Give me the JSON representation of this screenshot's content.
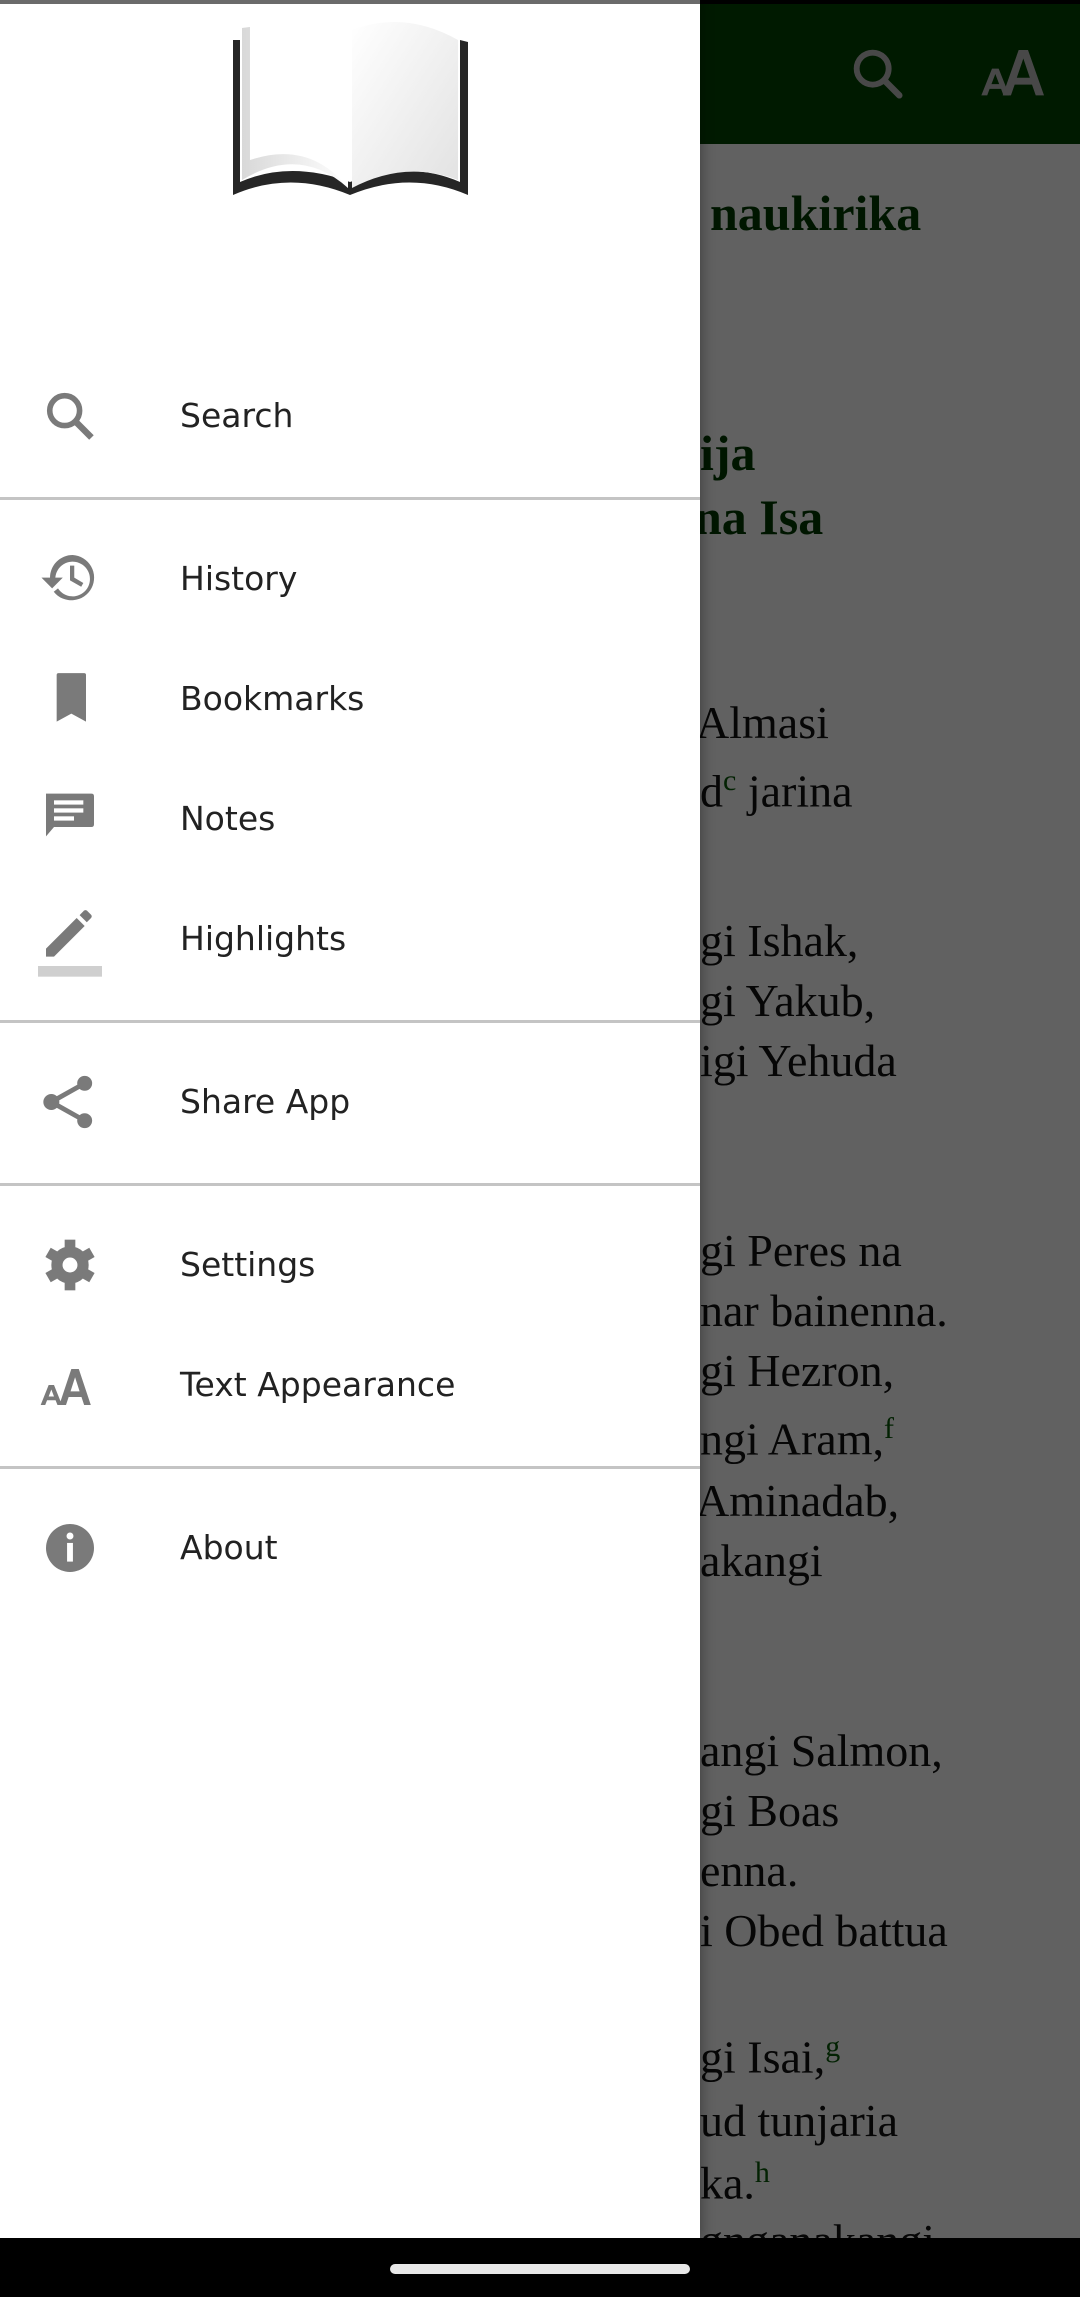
{
  "app": {
    "accent_color": "#004500",
    "icon_color": "#7a7a7a"
  },
  "appbar": {
    "search_icon": "search-icon",
    "text_appearance_icon": "text-size-icon"
  },
  "reader": {
    "lines": [
      {
        "text": "naukirika",
        "heading": true
      },
      {
        "text": "ija",
        "heading": true
      },
      {
        "text": "na Isa",
        "heading": true
      },
      {
        "text": "Almasi",
        "heading": false
      },
      {
        "text": "d",
        "sup": "c",
        "after": " jarina",
        "heading": false
      },
      {
        "text": "gi Ishak,",
        "heading": false
      },
      {
        "text": "gi Yakub,",
        "heading": false
      },
      {
        "text": "igi Yehuda",
        "heading": false
      },
      {
        "text": "gi Peres na",
        "heading": false
      },
      {
        "text": "nar bainenna.",
        "heading": false
      },
      {
        "text": "gi Hezron,",
        "heading": false
      },
      {
        "text": "ngi Aram,",
        "sup": "f",
        "heading": false
      },
      {
        "text": "Aminadab,",
        "heading": false
      },
      {
        "text": "akangi",
        "heading": false
      },
      {
        "text": "angi Salmon,",
        "heading": false
      },
      {
        "text": "gi Boas",
        "heading": false
      },
      {
        "text": "enna.",
        "heading": false
      },
      {
        "text": "i Obed battua",
        "heading": false
      },
      {
        "text": "gi Isai,",
        "sup": "g",
        "heading": false
      },
      {
        "text": "ud tunjaria",
        "heading": false
      },
      {
        "text": "ka.",
        "sup": "h",
        "heading": false
      },
      {
        "text": "gnganakangi",
        "heading": false
      }
    ]
  },
  "drawer": {
    "logo": "open-book-logo",
    "items": [
      {
        "id": "search",
        "label": "Search",
        "icon": "search-icon"
      },
      {
        "id": "history",
        "label": "History",
        "icon": "history-icon"
      },
      {
        "id": "bookmarks",
        "label": "Bookmarks",
        "icon": "bookmark-icon"
      },
      {
        "id": "notes",
        "label": "Notes",
        "icon": "notes-icon"
      },
      {
        "id": "highlights",
        "label": "Highlights",
        "icon": "highlight-pen-icon"
      },
      {
        "id": "share-app",
        "label": "Share App",
        "icon": "share-icon"
      },
      {
        "id": "settings",
        "label": "Settings",
        "icon": "gear-icon"
      },
      {
        "id": "text-appearance",
        "label": "Text Appearance",
        "icon": "text-size-icon"
      },
      {
        "id": "about",
        "label": "About",
        "icon": "info-icon"
      }
    ]
  }
}
